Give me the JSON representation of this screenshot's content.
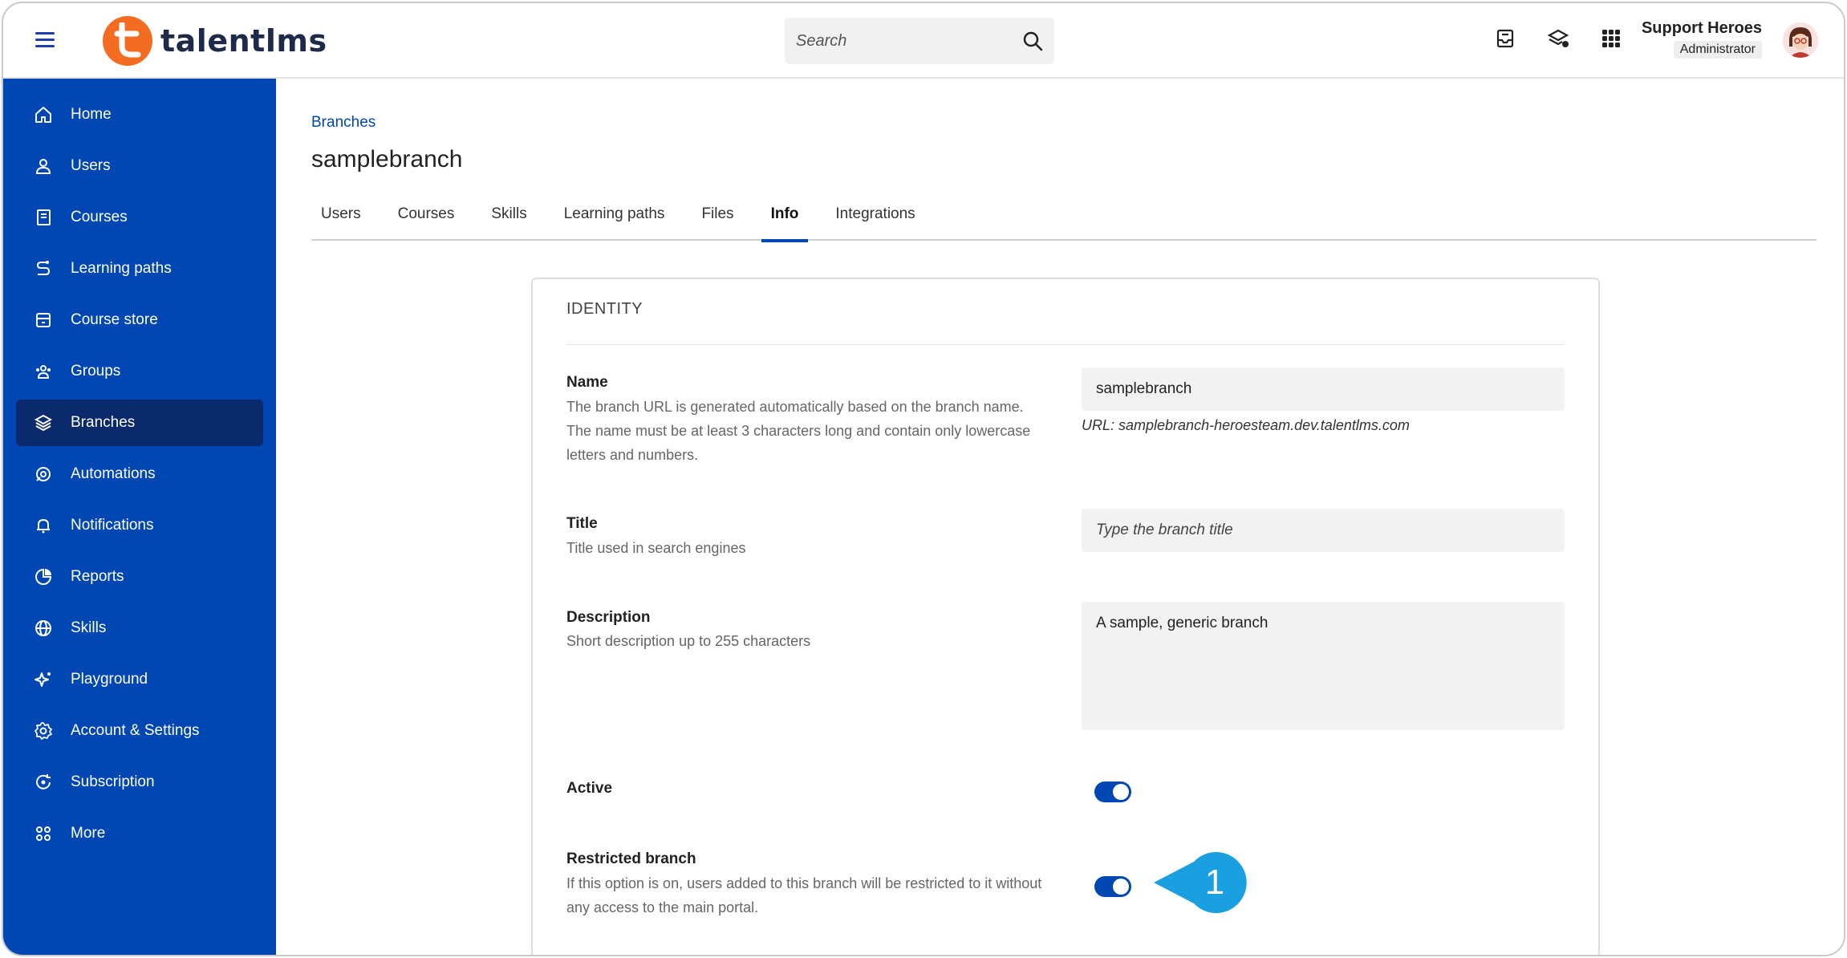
{
  "app": {
    "logo_text": "talentlms"
  },
  "search": {
    "placeholder": "Search"
  },
  "user": {
    "name": "Support Heroes",
    "role": "Administrator"
  },
  "sidebar": {
    "items": [
      {
        "label": "Home",
        "icon": "home-icon"
      },
      {
        "label": "Users",
        "icon": "user-icon"
      },
      {
        "label": "Courses",
        "icon": "book-icon"
      },
      {
        "label": "Learning paths",
        "icon": "path-icon"
      },
      {
        "label": "Course store",
        "icon": "store-icon"
      },
      {
        "label": "Groups",
        "icon": "groups-icon"
      },
      {
        "label": "Branches",
        "icon": "layers-icon",
        "active": true
      },
      {
        "label": "Automations",
        "icon": "automation-icon"
      },
      {
        "label": "Notifications",
        "icon": "bell-icon"
      },
      {
        "label": "Reports",
        "icon": "pie-icon"
      },
      {
        "label": "Skills",
        "icon": "globe-icon"
      },
      {
        "label": "Playground",
        "icon": "sparkle-icon"
      },
      {
        "label": "Account & Settings",
        "icon": "gear-icon"
      },
      {
        "label": "Subscription",
        "icon": "refresh-icon"
      },
      {
        "label": "More",
        "icon": "grid-dots-icon"
      }
    ]
  },
  "breadcrumb": "Branches",
  "page_title": "samplebranch",
  "tabs": [
    {
      "label": "Users"
    },
    {
      "label": "Courses"
    },
    {
      "label": "Skills"
    },
    {
      "label": "Learning paths"
    },
    {
      "label": "Files"
    },
    {
      "label": "Info",
      "active": true
    },
    {
      "label": "Integrations"
    }
  ],
  "identity": {
    "heading": "IDENTITY",
    "name": {
      "label": "Name",
      "help": "The branch URL is generated automatically based on the branch name. The name must be at least 3 characters long and contain only lowercase letters and numbers.",
      "value": "samplebranch",
      "url_note": "URL: samplebranch-heroesteam.dev.talentlms.com"
    },
    "title": {
      "label": "Title",
      "help": "Title used in search engines",
      "placeholder": "Type the branch title"
    },
    "description": {
      "label": "Description",
      "help": "Short description up to 255 characters",
      "value": "A sample, generic branch"
    },
    "active": {
      "label": "Active",
      "on": true
    },
    "restricted": {
      "label": "Restricted branch",
      "help": "If this option is on, users added to this branch will be restricted to it without any access to the main portal.",
      "on": true
    }
  },
  "callout": {
    "number": "1",
    "color": "#1a9fe0"
  },
  "colors": {
    "brand_blue": "#0047b3",
    "sidebar_active": "#0b2a6b",
    "logo_orange": "#f36c21"
  }
}
